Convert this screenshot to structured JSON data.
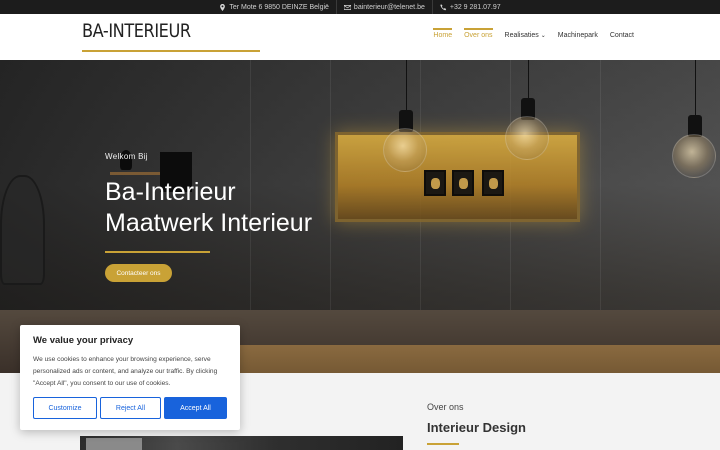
{
  "topbar": {
    "address": "Ter Mote 6 9850 DEINZE België",
    "email": "bainterieur@telenet.be",
    "phone": "+32 9 281.07.97",
    "icons": [
      "location-pin-icon",
      "envelope-icon",
      "phone-icon"
    ]
  },
  "header": {
    "logo": "BA-INTERIEUR",
    "nav": [
      {
        "label": "Home"
      },
      {
        "label": "Over ons"
      },
      {
        "label": "Realisaties"
      },
      {
        "label": "Machinepark"
      },
      {
        "label": "Contact"
      }
    ]
  },
  "hero": {
    "welcome": "Welkom Bij",
    "title": "Ba-Interieur",
    "subtitle": "Maatwerk Interieur",
    "button": "Contacteer ons"
  },
  "about": {
    "kicker": "Over ons",
    "title": "Interieur Design"
  },
  "cookie": {
    "title": "We value your privacy",
    "text": "We use cookies to enhance your browsing experience, serve personalized ads or content, and analyze our traffic. By clicking \"Accept All\", you consent to our use of cookies.",
    "customize": "Customize",
    "reject": "Reject All",
    "accept": "Accept All"
  },
  "colors": {
    "accent": "#c9a236",
    "topbar": "#1c1c1c",
    "cookie_blue": "#1863dc"
  }
}
